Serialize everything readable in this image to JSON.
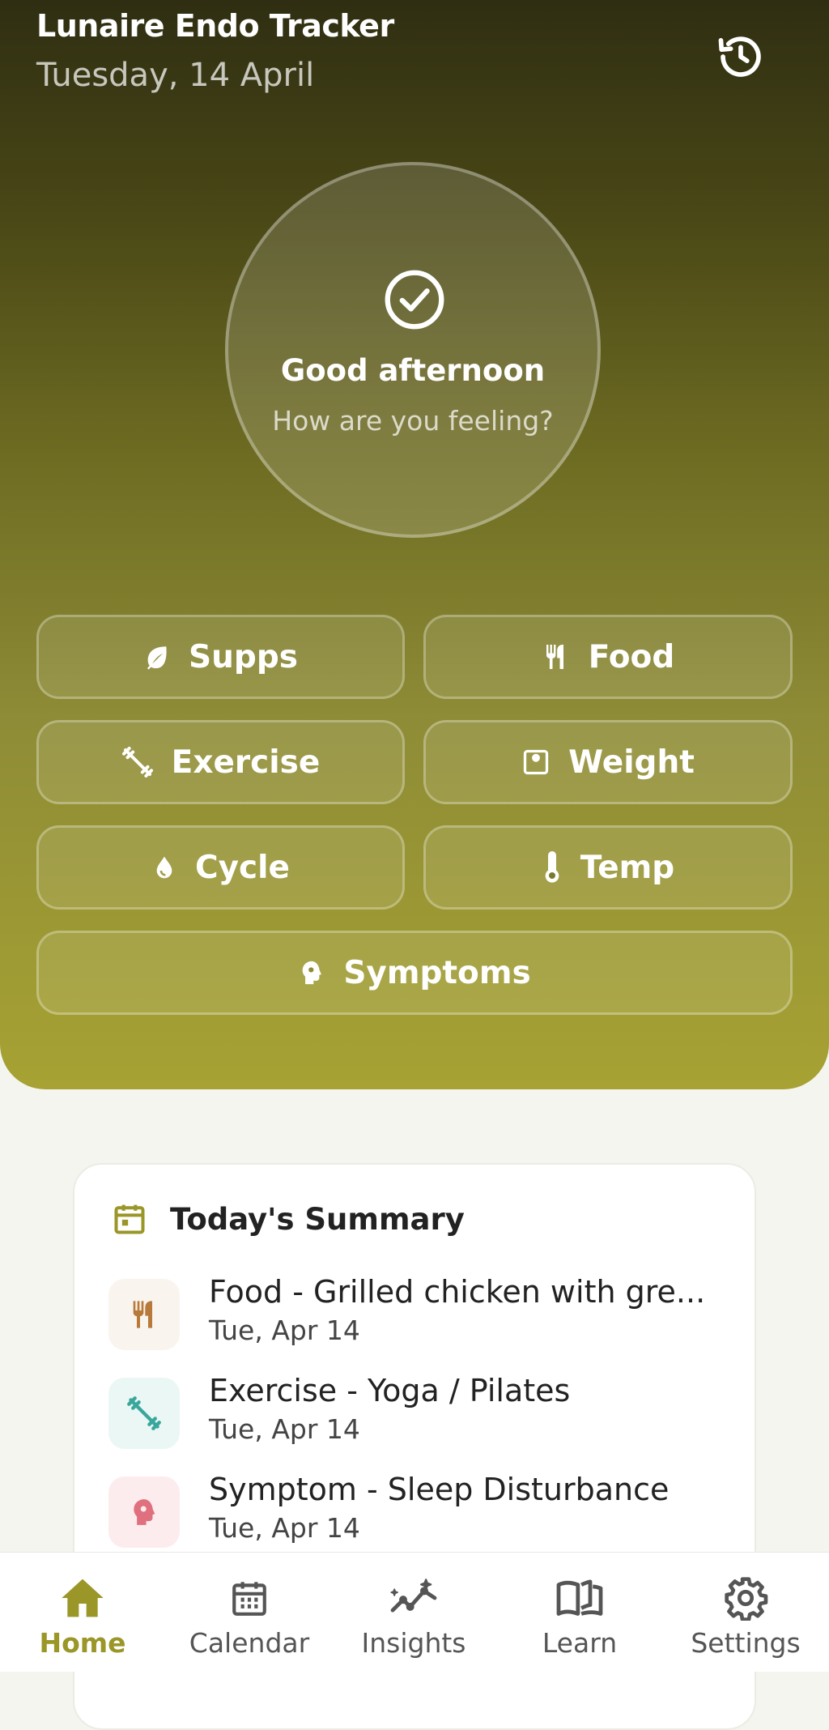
{
  "header": {
    "title": "Lunaire Endo Tracker",
    "date": "Tuesday, 14 April",
    "history_icon": "history-icon"
  },
  "greeting": {
    "title": "Good afternoon",
    "subtitle": "How are you feeling?",
    "icon": "check-circle-icon"
  },
  "quick_actions": [
    {
      "label": "Supps",
      "icon": "leaf-icon"
    },
    {
      "label": "Food",
      "icon": "utensils-icon"
    },
    {
      "label": "Exercise",
      "icon": "dumbbell-icon"
    },
    {
      "label": "Weight",
      "icon": "scale-icon"
    },
    {
      "label": "Cycle",
      "icon": "drop-icon"
    },
    {
      "label": "Temp",
      "icon": "thermometer-icon"
    },
    {
      "label": "Symptoms",
      "icon": "head-icon"
    }
  ],
  "summary": {
    "title": "Today's Summary",
    "icon": "calendar-icon",
    "entries": [
      {
        "title": "Food - Grilled chicken with gre...",
        "date": "Tue, Apr 14",
        "icon": "utensils-icon",
        "color": "#b87a3a",
        "bg": "#faf4ee"
      },
      {
        "title": "Exercise - Yoga / Pilates",
        "date": "Tue, Apr 14",
        "icon": "dumbbell-icon",
        "color": "#3aa79c",
        "bg": "#eaf7f5"
      },
      {
        "title": "Symptom - Sleep Disturbance",
        "date": "Tue, Apr 14",
        "icon": "head-icon",
        "color": "#e0707e",
        "bg": "#fcecee"
      }
    ]
  },
  "tabs": [
    {
      "label": "Home",
      "icon": "home-icon",
      "active": true
    },
    {
      "label": "Calendar",
      "icon": "calendar-icon",
      "active": false
    },
    {
      "label": "Insights",
      "icon": "insights-icon",
      "active": false
    },
    {
      "label": "Learn",
      "icon": "book-icon",
      "active": false
    },
    {
      "label": "Settings",
      "icon": "gear-icon",
      "active": false
    }
  ],
  "colors": {
    "accent": "#9a9628",
    "hero_top": "#2f2e12",
    "hero_bottom": "#a7a233",
    "background": "#f5f5f0"
  }
}
